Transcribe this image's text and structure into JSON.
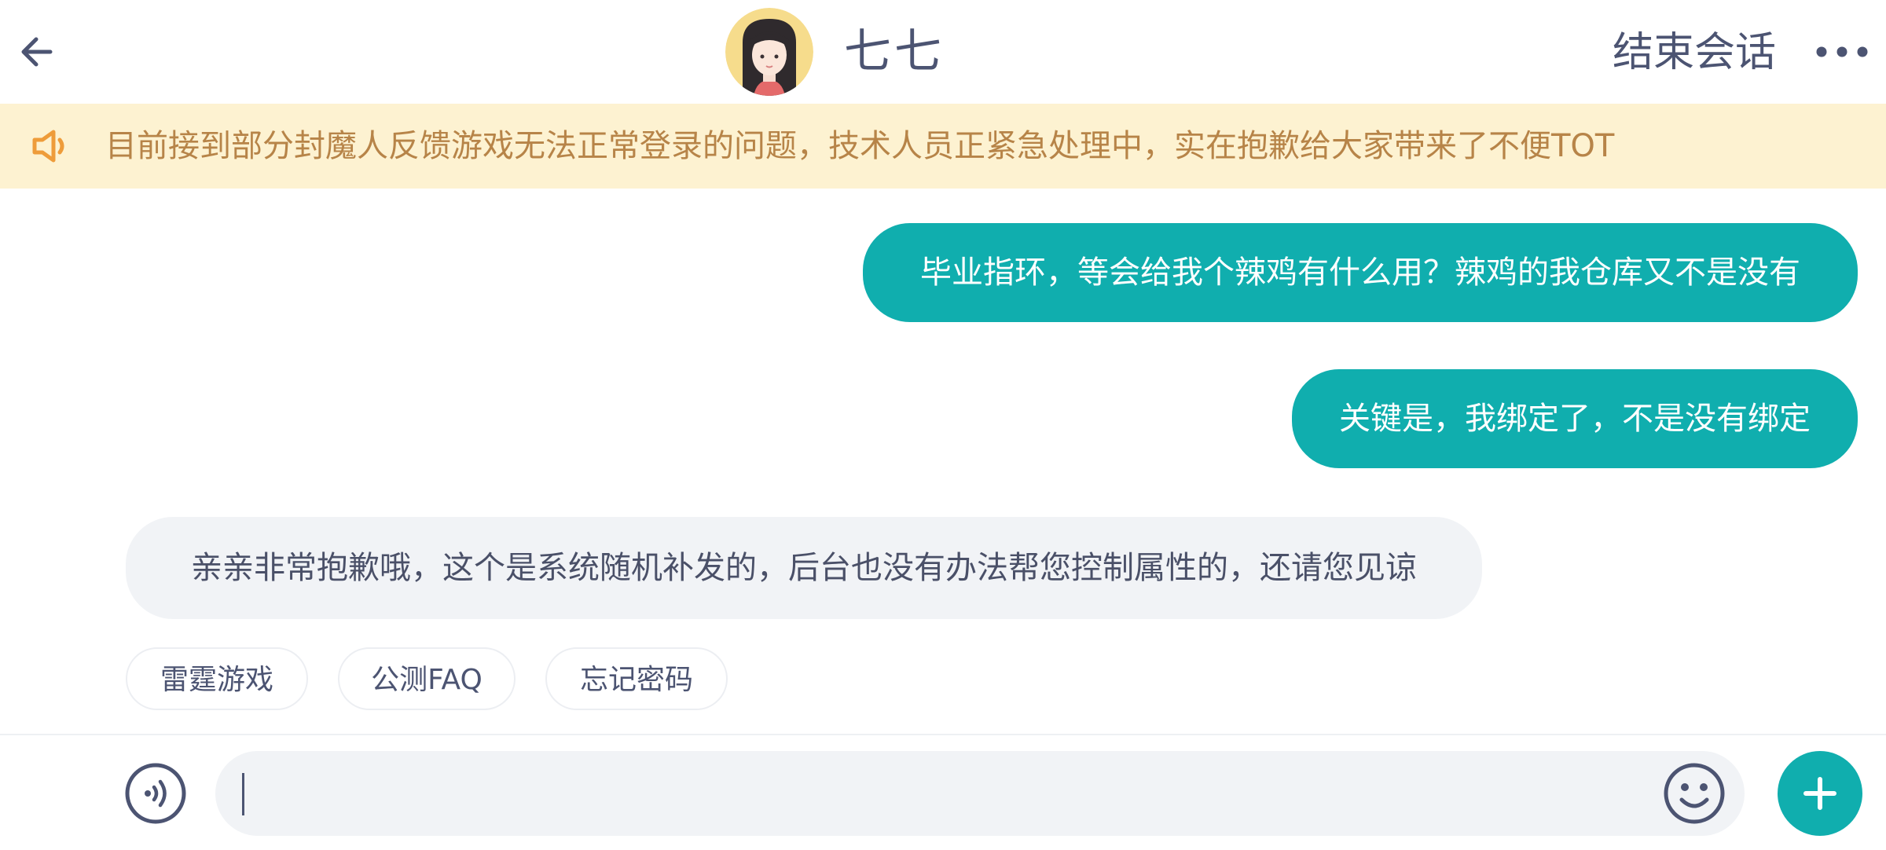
{
  "header": {
    "back_icon": "arrow-left-icon",
    "title": "七七",
    "end_chat_label": "结束会话",
    "more_icon": "more-dots-icon"
  },
  "notice": {
    "icon": "speaker-icon",
    "text": "目前接到部分封魔人反馈游戏无法正常登录的问题，技术人员正紧急处理中，实在抱歉给大家带来了不便TOT"
  },
  "messages": [
    {
      "from": "user",
      "text": "毕业指环，等会给我个辣鸡有什么用？辣鸡的我仓库又不是没有"
    },
    {
      "from": "user",
      "text": "关键是，我绑定了，不是没有绑定"
    },
    {
      "from": "agent",
      "text": "亲亲非常抱歉哦，这个是系统随机补发的，后台也没有办法帮您控制属性的，还请您见谅"
    }
  ],
  "quick_replies": [
    "雷霆游戏",
    "公测FAQ",
    "忘记密码"
  ],
  "input": {
    "value": "",
    "voice_icon": "voice-icon",
    "emoji_icon": "emoji-icon",
    "plus_icon": "plus-icon"
  },
  "colors": {
    "accent": "#10aeae",
    "header_text": "#4c5472",
    "notice_bg": "#fdf2d1",
    "notice_text": "#b78448",
    "agent_bubble": "#f1f3f6"
  }
}
